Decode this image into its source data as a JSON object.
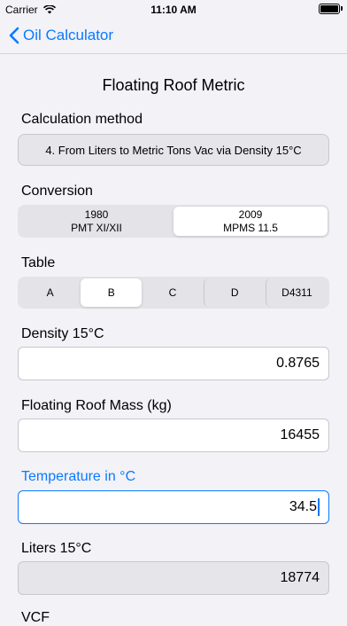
{
  "status_bar": {
    "carrier": "Carrier",
    "time": "11:10 AM"
  },
  "nav": {
    "back_label": "Oil Calculator"
  },
  "page_title": "Floating Roof Metric",
  "calculation_method": {
    "label": "Calculation method",
    "value": "4. From Liters to Metric Tons Vac via Density 15°C"
  },
  "conversion": {
    "label": "Conversion",
    "options": [
      {
        "line1": "1980",
        "line2": "PMT XI/XII"
      },
      {
        "line1": "2009",
        "line2": "MPMS 11.5"
      }
    ],
    "selected": "2009 MPMS 11.5"
  },
  "table": {
    "label": "Table",
    "options": [
      "A",
      "B",
      "C",
      "D",
      "D4311"
    ],
    "selected": "B"
  },
  "fields": {
    "density": {
      "label": "Density 15°C",
      "value": "0.8765"
    },
    "roof_mass": {
      "label": "Floating Roof Mass (kg)",
      "value": "16455"
    },
    "temperature": {
      "label": "Temperature in °C",
      "value": "34.5"
    },
    "liters": {
      "label": "Liters 15°C",
      "value": "18774"
    }
  },
  "cut_off_label": "VCF",
  "colors": {
    "accent": "#0a7aff",
    "background": "#f2f2f7"
  }
}
